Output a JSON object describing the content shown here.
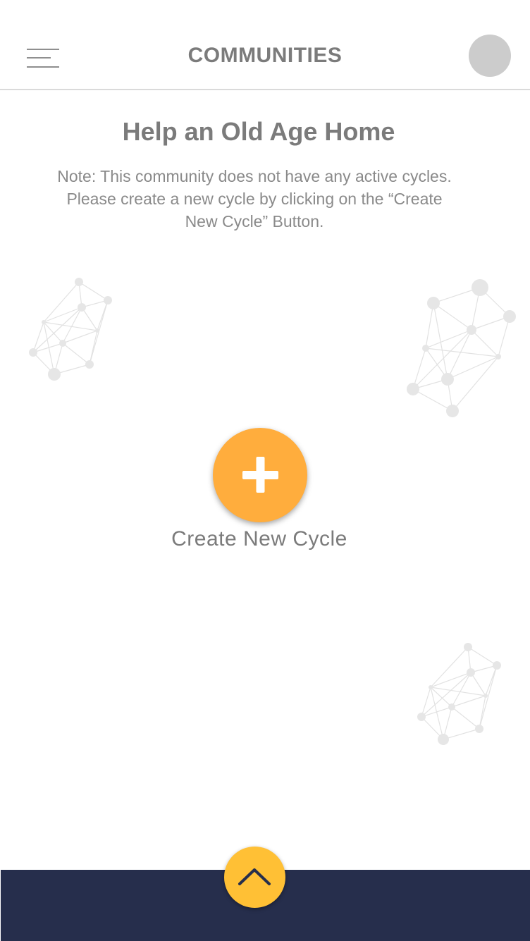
{
  "header": {
    "title": "COMMUNITIES"
  },
  "community": {
    "name": "Help an Old Age Home",
    "note": "Note: This community does not have any active cycles. Please create a new cycle by clicking on the “Create New Cycle” Button."
  },
  "actions": {
    "create_label": "Create New Cycle"
  },
  "colors": {
    "accent": "#ffad3d",
    "up_button": "#ffc035",
    "bottom_bar": "#262e4c",
    "text": "#7b7b7b"
  },
  "icons": {
    "menu": "hamburger-menu-icon",
    "create": "plus-icon",
    "expand": "chevron-up-icon",
    "decoration": "network-graph-icon"
  }
}
